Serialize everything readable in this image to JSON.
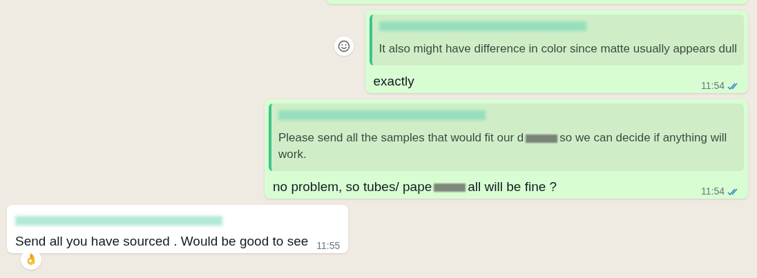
{
  "messages": [
    {
      "kind": "outgoing",
      "partial": true
    },
    {
      "kind": "outgoing",
      "react_button": true,
      "quote": {
        "segments": [
          {
            "kind": "text",
            "value": "It also might have difference in color since matte usually appears dull"
          }
        ]
      },
      "segments": [
        {
          "kind": "text",
          "value": "exactly"
        }
      ],
      "time": "11:54",
      "read": true
    },
    {
      "kind": "outgoing",
      "react_button": false,
      "quote": {
        "segments": [
          {
            "kind": "text",
            "value": "Please send all the samples that would fit our d"
          },
          {
            "kind": "redacted"
          },
          {
            "kind": "text",
            "value": "so we can decide if anything will work."
          }
        ]
      },
      "segments": [
        {
          "kind": "text",
          "value": "no problem, so tubes/ pape"
        },
        {
          "kind": "redacted"
        },
        {
          "kind": "text",
          "value": "all will be fine  ?"
        }
      ],
      "time": "11:54",
      "read": true
    },
    {
      "kind": "incoming",
      "sender_hidden": true,
      "segments": [
        {
          "kind": "text",
          "value": "Send all you have sourced . Would be good to see"
        }
      ],
      "time": "11:55",
      "reaction": "👌"
    }
  ]
}
